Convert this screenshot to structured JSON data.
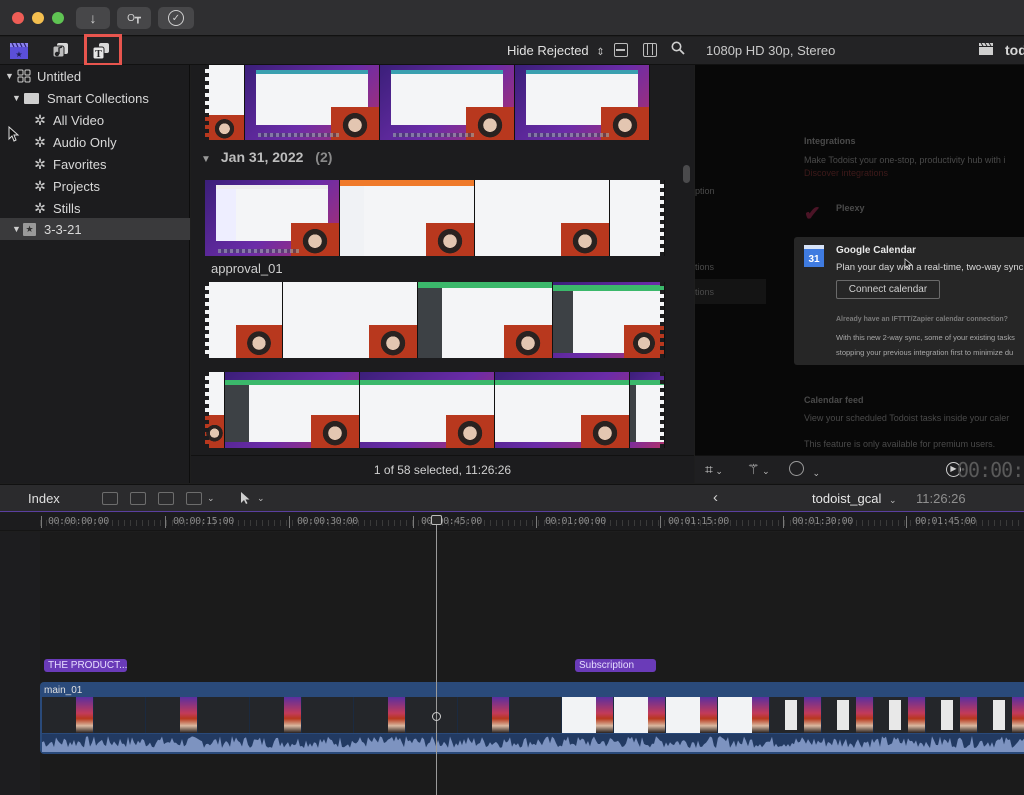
{
  "titlebar": {
    "buttons": [
      {
        "name": "import-media",
        "icon": "download-arrow-icon",
        "glyph": "↓"
      },
      {
        "name": "keywords",
        "icon": "key-icon",
        "glyph": "O┳"
      },
      {
        "name": "background-tasks",
        "icon": "checkmark-circle-icon",
        "glyph": "✓"
      }
    ]
  },
  "toolbar": {
    "library_tabs": [
      {
        "name": "libraries",
        "icon": "clapperboard-star-icon"
      },
      {
        "name": "photos-audio",
        "icon": "photos-music-icon"
      },
      {
        "name": "titles-generators",
        "icon": "titles-t-icon",
        "highlighted": true
      }
    ],
    "filter_label": "Hide Rejected",
    "viewer_format": "1080p HD 30p, Stereo",
    "viewer_project_truncated": "tod",
    "highlight_color": "#e8554e"
  },
  "sidebar": {
    "library": "Untitled",
    "smart_collections_label": "Smart Collections",
    "collections": [
      "All Video",
      "Audio Only",
      "Favorites",
      "Projects",
      "Stills"
    ],
    "event": "3-3-21"
  },
  "browser": {
    "date_group": "Jan 31, 2022",
    "date_group_count": "(2)",
    "clip_label": "approval_01",
    "status": "1 of 58 selected, 11:26:26"
  },
  "viewer": {
    "integrations_heading": "Integrations",
    "integrations_desc": "Make Todoist your one-stop, productivity hub with i",
    "discover_link": "Discover integrations",
    "side_labels": [
      "ption",
      "tions",
      "tions"
    ],
    "pleexy": "Pleexy",
    "gcal_title": "Google Calendar",
    "gcal_icon_text": "31",
    "gcal_desc": "Plan your day with a real-time, two-way sync",
    "connect_button": "Connect calendar",
    "ifttt_note": "Already have an IFTTT/Zapier calendar connection?",
    "sync_note_1": "With this new 2-way sync, some of your existing tasks",
    "sync_note_2": "stopping your previous integration first to minimize du",
    "calendar_feed_heading": "Calendar feed",
    "calendar_feed_desc": "View your scheduled Todoist tasks inside your caler",
    "premium_note": "This feature is only available for premium users.",
    "timecode": "00:00:0"
  },
  "timeline": {
    "index_label": "Index",
    "project_name": "todoist_gcal",
    "project_duration": "11:26:26",
    "ruler_labels": [
      "00:00:00:00",
      "00:00:15:00",
      "00:00:30:00",
      "00:00:45:00",
      "00:01:00:00",
      "00:01:15:00",
      "00:01:30:00",
      "00:01:45:00"
    ],
    "title_clips": [
      "THE PRODUCT...",
      "Subscription"
    ],
    "main_clip_label": "main_01",
    "title_clip_color": "#6a3bb8",
    "main_clip_color": "#2a4a7a"
  }
}
